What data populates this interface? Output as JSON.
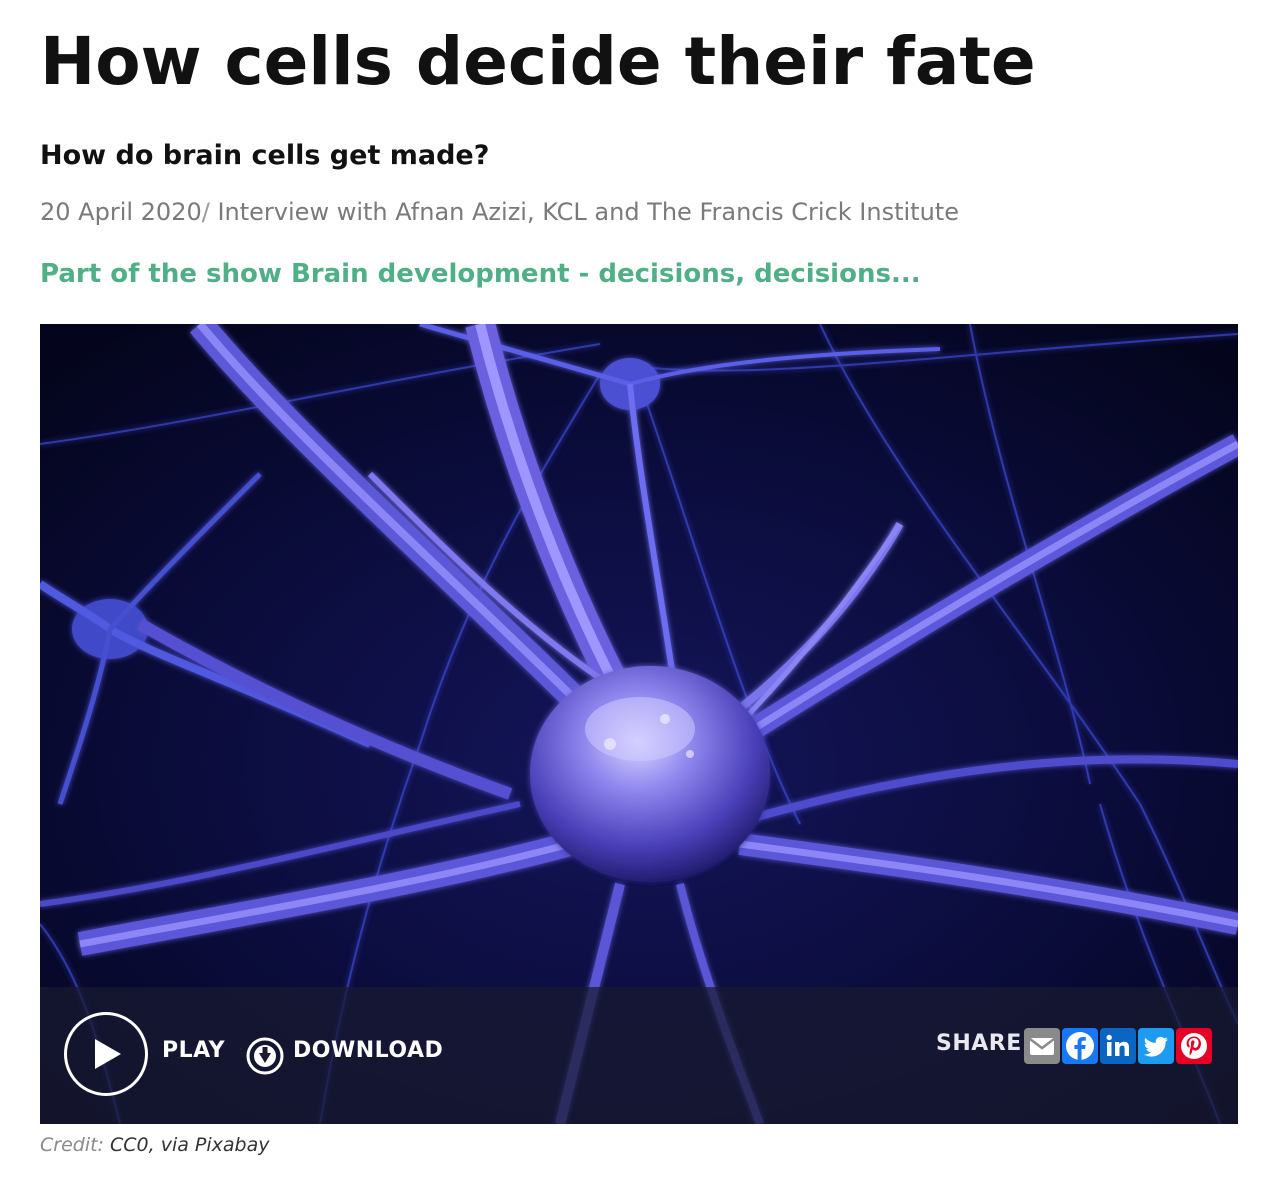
{
  "article": {
    "title": "How cells decide their fate",
    "subtitle": "How do brain cells get made?",
    "date": "20 April 2020",
    "separator": "/",
    "byline": "Interview with Afnan Azizi, KCL and The Francis Crick Institute",
    "show_link": "Part of the show Brain development - decisions, decisions..."
  },
  "player": {
    "play_label": "PLAY",
    "download_label": "DOWNLOAD",
    "share_label": "SHARE",
    "share_icons": [
      "email-icon",
      "facebook-icon",
      "linkedin-icon",
      "twitter-icon",
      "pinterest-icon"
    ],
    "share_colors": {
      "email": "#8a8a8a",
      "facebook": "#1877f2",
      "linkedin": "#0a66c2",
      "twitter": "#1d9bf0",
      "pinterest": "#e60023"
    }
  },
  "image": {
    "subject": "neuron",
    "background_color": "#07082a",
    "glow_color": "#7b6cff"
  },
  "credit": {
    "key": "Credit:",
    "value": "CC0, via Pixabay"
  },
  "colors": {
    "show_link": "#4faf86",
    "meta_text": "#7a7a7a"
  }
}
